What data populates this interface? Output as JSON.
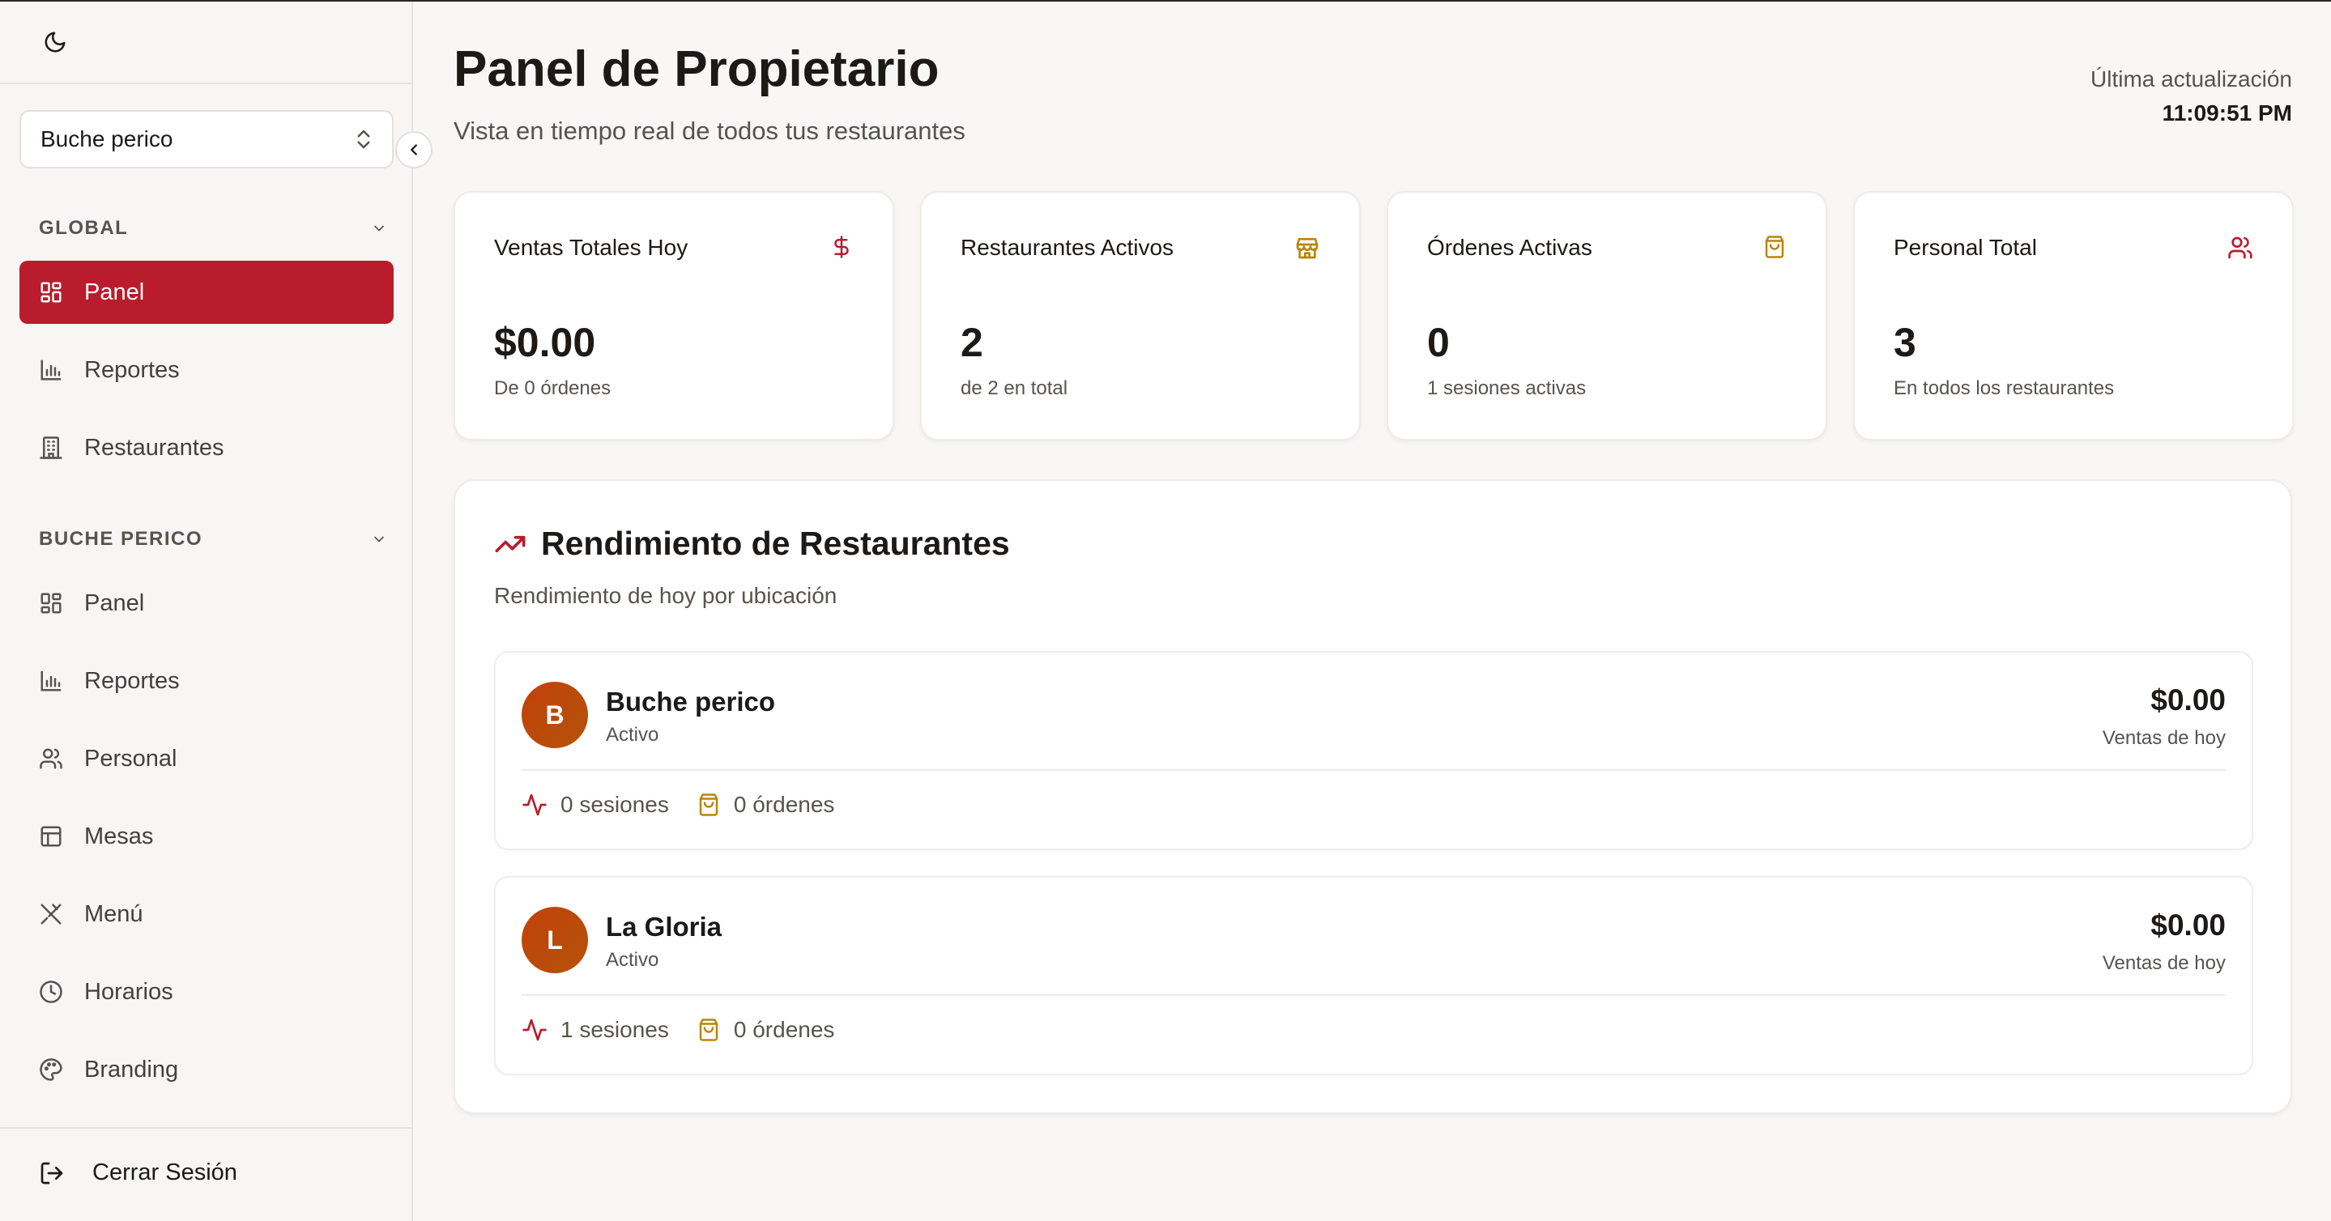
{
  "colors": {
    "accent": "#b91c2c",
    "gold": "#b8860b",
    "text": "#1c1917",
    "muted": "#57534e"
  },
  "sidebar": {
    "theme_icon": "moon-icon",
    "selector": {
      "value": "Buche perico",
      "icon": "chevron-up-down-icon"
    },
    "collapse_icon": "chevron-left-icon",
    "groups": [
      {
        "label": "GLOBAL",
        "items": [
          {
            "label": "Panel",
            "icon": "grid-icon",
            "active": true
          },
          {
            "label": "Reportes",
            "icon": "bar-chart-icon"
          },
          {
            "label": "Restaurantes",
            "icon": "building-icon"
          }
        ]
      },
      {
        "label": "BUCHE PERICO",
        "items": [
          {
            "label": "Panel",
            "icon": "grid-icon"
          },
          {
            "label": "Reportes",
            "icon": "bar-chart-icon"
          },
          {
            "label": "Personal",
            "icon": "users-icon"
          },
          {
            "label": "Mesas",
            "icon": "table-icon"
          },
          {
            "label": "Menú",
            "icon": "utensils-icon"
          },
          {
            "label": "Horarios",
            "icon": "clock-icon"
          },
          {
            "label": "Branding",
            "icon": "palette-icon"
          }
        ]
      }
    ],
    "logout": {
      "label": "Cerrar Sesión",
      "icon": "logout-icon"
    }
  },
  "header": {
    "title": "Panel de Propietario",
    "subtitle": "Vista en tiempo real de todos tus restaurantes",
    "updated_label": "Última actualización",
    "updated_time": "11:09:51 PM"
  },
  "stats": [
    {
      "title": "Ventas Totales Hoy",
      "value": "$0.00",
      "desc": "De 0 órdenes",
      "icon": "dollar-icon"
    },
    {
      "title": "Restaurantes Activos",
      "value": "2",
      "desc": "de 2 en total",
      "icon": "store-icon"
    },
    {
      "title": "Órdenes Activas",
      "value": "0",
      "desc": "1 sesiones activas",
      "icon": "shopping-bag-icon"
    },
    {
      "title": "Personal Total",
      "value": "3",
      "desc": "En todos los restaurantes",
      "icon": "users-icon"
    }
  ],
  "performance": {
    "title": "Rendimiento de Restaurantes",
    "title_icon": "trending-up-icon",
    "subtitle": "Rendimiento de hoy por ubicación",
    "restaurants": [
      {
        "initial": "B",
        "name": "Buche perico",
        "status": "Activo",
        "sales": "$0.00",
        "sales_label": "Ventas de hoy",
        "sessions": "0 sesiones",
        "orders": "0 órdenes"
      },
      {
        "initial": "L",
        "name": "La Gloria",
        "status": "Activo",
        "sales": "$0.00",
        "sales_label": "Ventas de hoy",
        "sessions": "1 sesiones",
        "orders": "0 órdenes"
      }
    ]
  }
}
